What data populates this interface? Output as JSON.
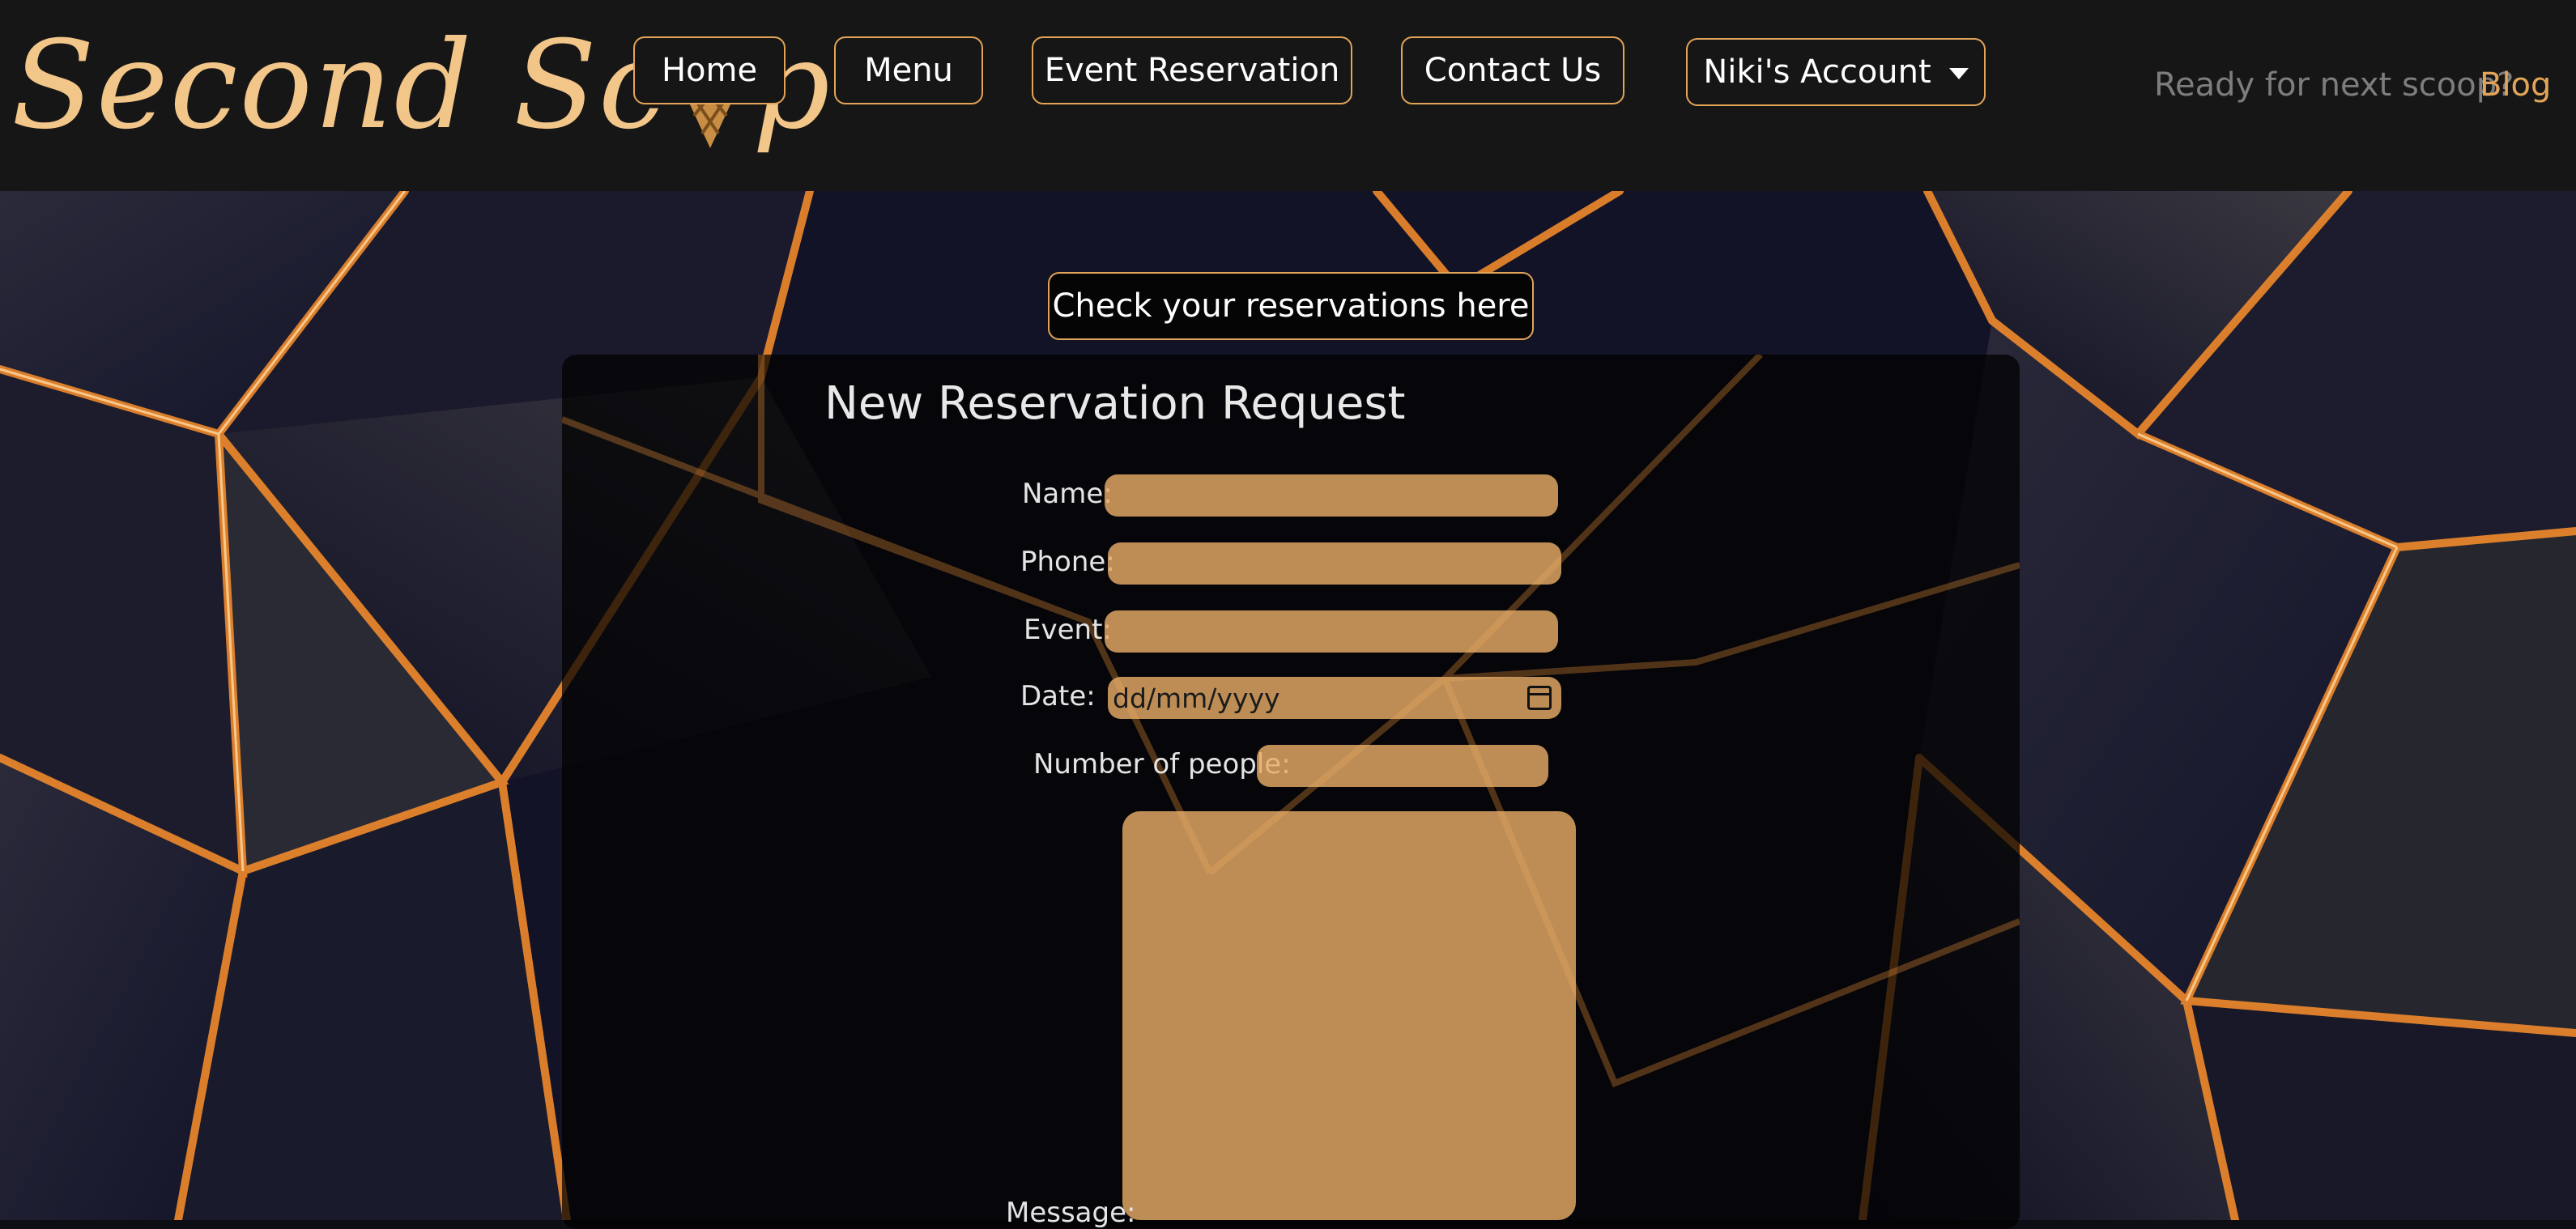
{
  "brand": {
    "name_part1": "Second Sc",
    "name_part2": "p",
    "logo_icon": "ice-cream-cone-icon",
    "color": "#f2c589"
  },
  "nav": {
    "home": "Home",
    "menu": "Menu",
    "event_reservation": "Event Reservation",
    "contact_us": "Contact Us",
    "account": "Niki's Account",
    "tagline": "Ready for next scoop?",
    "blog": "Blog"
  },
  "colors": {
    "accent": "#e2a458",
    "navbar_bg": "#161616",
    "field_bg": "#d9a066"
  },
  "main": {
    "check_reservations_label": "Check your reservations here",
    "form": {
      "title": "New Reservation Request",
      "name_label": "Name:",
      "phone_label": "Phone:",
      "event_label": "Event:",
      "date_label": "Date:",
      "date_placeholder": "dd/mm/yyyy",
      "people_label": "Number of people:",
      "message_label": "Message:"
    }
  }
}
